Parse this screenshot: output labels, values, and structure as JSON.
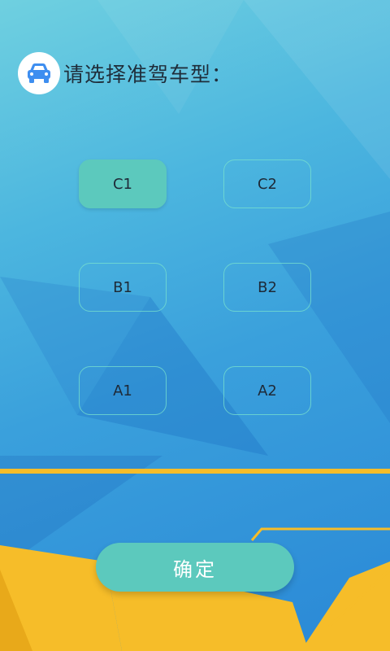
{
  "header": {
    "title": "请选择准驾车型：",
    "icon": "car-icon"
  },
  "options": [
    {
      "label": "C1",
      "selected": true
    },
    {
      "label": "C2",
      "selected": false
    },
    {
      "label": "B1",
      "selected": false
    },
    {
      "label": "B2",
      "selected": false
    },
    {
      "label": "A1",
      "selected": false
    },
    {
      "label": "A2",
      "selected": false
    }
  ],
  "confirm": {
    "label": "确定"
  },
  "colors": {
    "accent": "#5cc9bd",
    "stripe": "#f6bd29",
    "icon_blue": "#3e8ef0"
  }
}
